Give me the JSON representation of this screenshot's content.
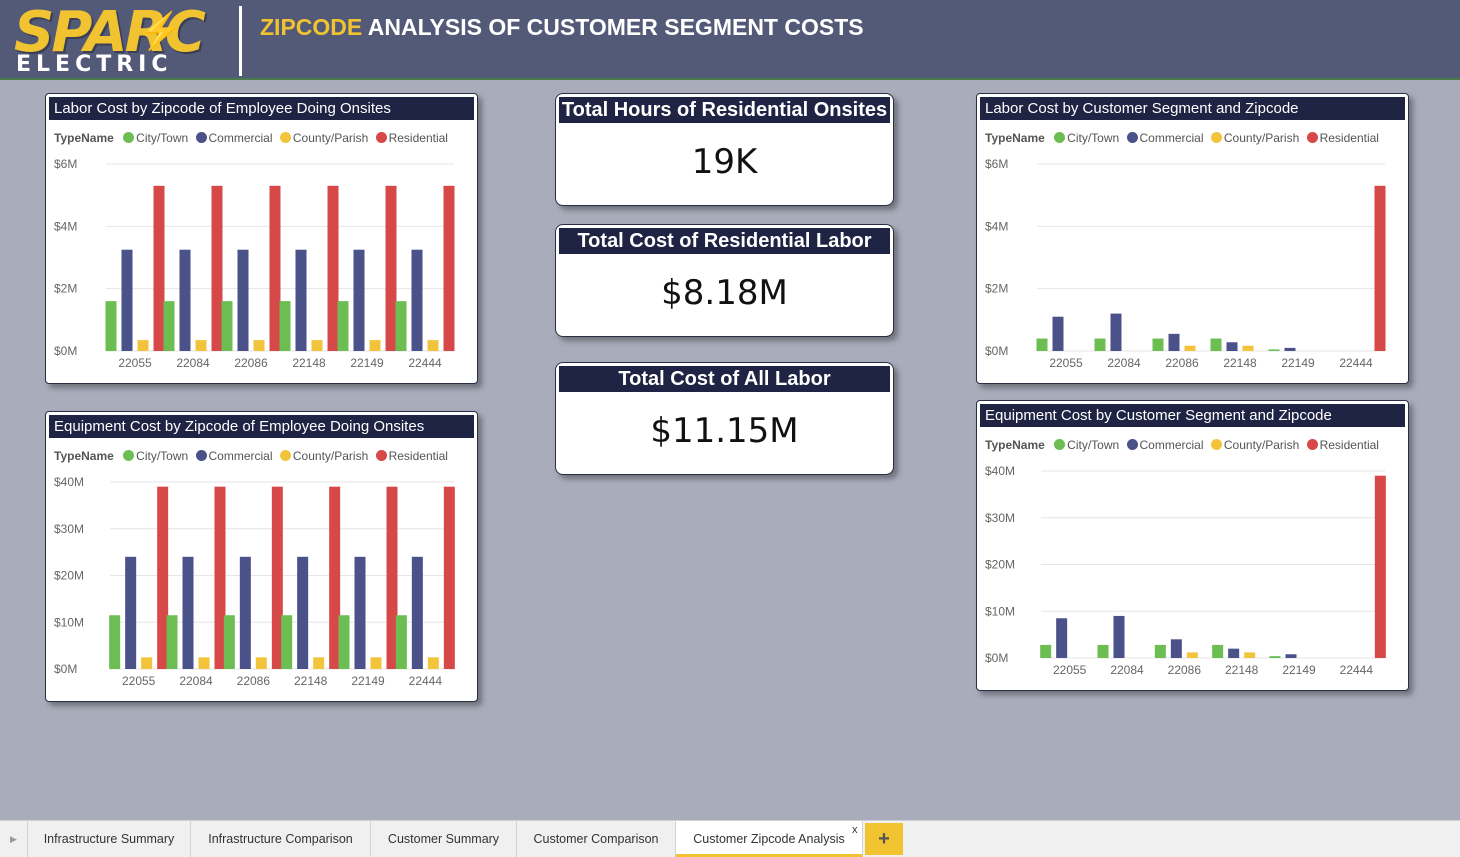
{
  "header": {
    "logo_top": "SPARC",
    "logo_bottom": "ELECTRIC",
    "title_highlight": "ZIPCODE",
    "title_rest": " ANALYSIS OF CUSTOMER SEGMENT COSTS"
  },
  "colors": {
    "city_town": "#6cbd52",
    "commercial": "#4a5289",
    "county_parish": "#f2c43c",
    "residential": "#d74848",
    "header_bg": "#525a78",
    "title_bar": "#1f2444",
    "accent": "#f2c331"
  },
  "legend": {
    "heading": "TypeName",
    "items": [
      "City/Town",
      "Commercial",
      "County/Parish",
      "Residential"
    ]
  },
  "cards": [
    {
      "title": "Total Hours of Residential Onsites",
      "value": "19K"
    },
    {
      "title": "Total Cost of Residential Labor",
      "value": "$8.18M"
    },
    {
      "title": "Total Cost of All Labor",
      "value": "$11.15M"
    }
  ],
  "chart_data": [
    {
      "type": "bar",
      "title": "Labor Cost by Zipcode of Employee Doing Onsites",
      "categories": [
        "22055",
        "22084",
        "22086",
        "22148",
        "22149",
        "22444"
      ],
      "yticks": [
        "$0M",
        "$2M",
        "$4M",
        "$6M"
      ],
      "ylim": [
        0,
        6
      ],
      "series": [
        {
          "name": "City/Town",
          "values": [
            1.6,
            1.6,
            1.6,
            1.6,
            1.6,
            1.6
          ]
        },
        {
          "name": "Commercial",
          "values": [
            3.25,
            3.25,
            3.25,
            3.25,
            3.25,
            3.25
          ]
        },
        {
          "name": "County/Parish",
          "values": [
            0.35,
            0.35,
            0.35,
            0.35,
            0.35,
            0.35
          ]
        },
        {
          "name": "Residential",
          "values": [
            5.3,
            5.3,
            5.3,
            5.3,
            5.3,
            5.3
          ]
        }
      ]
    },
    {
      "type": "bar",
      "title": "Equipment Cost by Zipcode of Employee Doing Onsites",
      "categories": [
        "22055",
        "22084",
        "22086",
        "22148",
        "22149",
        "22444"
      ],
      "yticks": [
        "$0M",
        "$10M",
        "$20M",
        "$30M",
        "$40M"
      ],
      "ylim": [
        0,
        40
      ],
      "series": [
        {
          "name": "City/Town",
          "values": [
            11.5,
            11.5,
            11.5,
            11.5,
            11.5,
            11.5
          ]
        },
        {
          "name": "Commercial",
          "values": [
            24,
            24,
            24,
            24,
            24,
            24
          ]
        },
        {
          "name": "County/Parish",
          "values": [
            2.5,
            2.5,
            2.5,
            2.5,
            2.5,
            2.5
          ]
        },
        {
          "name": "Residential",
          "values": [
            39,
            39,
            39,
            39,
            39,
            39
          ]
        }
      ]
    },
    {
      "type": "bar",
      "title": "Labor Cost by Customer Segment and Zipcode",
      "categories": [
        "22055",
        "22084",
        "22086",
        "22148",
        "22149",
        "22444"
      ],
      "yticks": [
        "$0M",
        "$2M",
        "$4M",
        "$6M"
      ],
      "ylim": [
        0,
        6
      ],
      "series": [
        {
          "name": "City/Town",
          "values": [
            0.4,
            0.4,
            0.4,
            0.4,
            0.05,
            0
          ]
        },
        {
          "name": "Commercial",
          "values": [
            1.1,
            1.2,
            0.55,
            0.28,
            0.1,
            0
          ]
        },
        {
          "name": "County/Parish",
          "values": [
            0,
            0,
            0.17,
            0.17,
            0,
            0
          ]
        },
        {
          "name": "Residential",
          "values": [
            0,
            0,
            0,
            0,
            0,
            5.3
          ]
        }
      ]
    },
    {
      "type": "bar",
      "title": "Equipment Cost by Customer Segment and Zipcode",
      "categories": [
        "22055",
        "22084",
        "22086",
        "22148",
        "22149",
        "22444"
      ],
      "yticks": [
        "$0M",
        "$10M",
        "$20M",
        "$30M",
        "$40M"
      ],
      "ylim": [
        0,
        40
      ],
      "series": [
        {
          "name": "City/Town",
          "values": [
            2.8,
            2.8,
            2.8,
            2.8,
            0.4,
            0
          ]
        },
        {
          "name": "Commercial",
          "values": [
            8.5,
            9,
            4,
            2,
            0.8,
            0
          ]
        },
        {
          "name": "County/Parish",
          "values": [
            0,
            0,
            1.2,
            1.2,
            0,
            0
          ]
        },
        {
          "name": "Residential",
          "values": [
            0,
            0,
            0,
            0,
            0,
            39
          ]
        }
      ]
    }
  ],
  "tabs": [
    {
      "label": "Infrastructure Summary",
      "active": false
    },
    {
      "label": "Infrastructure Comparison",
      "active": false
    },
    {
      "label": "Customer Summary",
      "active": false
    },
    {
      "label": "Customer Comparison",
      "active": false
    },
    {
      "label": "Customer Zipcode Analysis",
      "active": true
    }
  ],
  "tabbar": {
    "scroll_icon": "triangle-right-icon",
    "close_label": "x",
    "add_label": "+"
  }
}
